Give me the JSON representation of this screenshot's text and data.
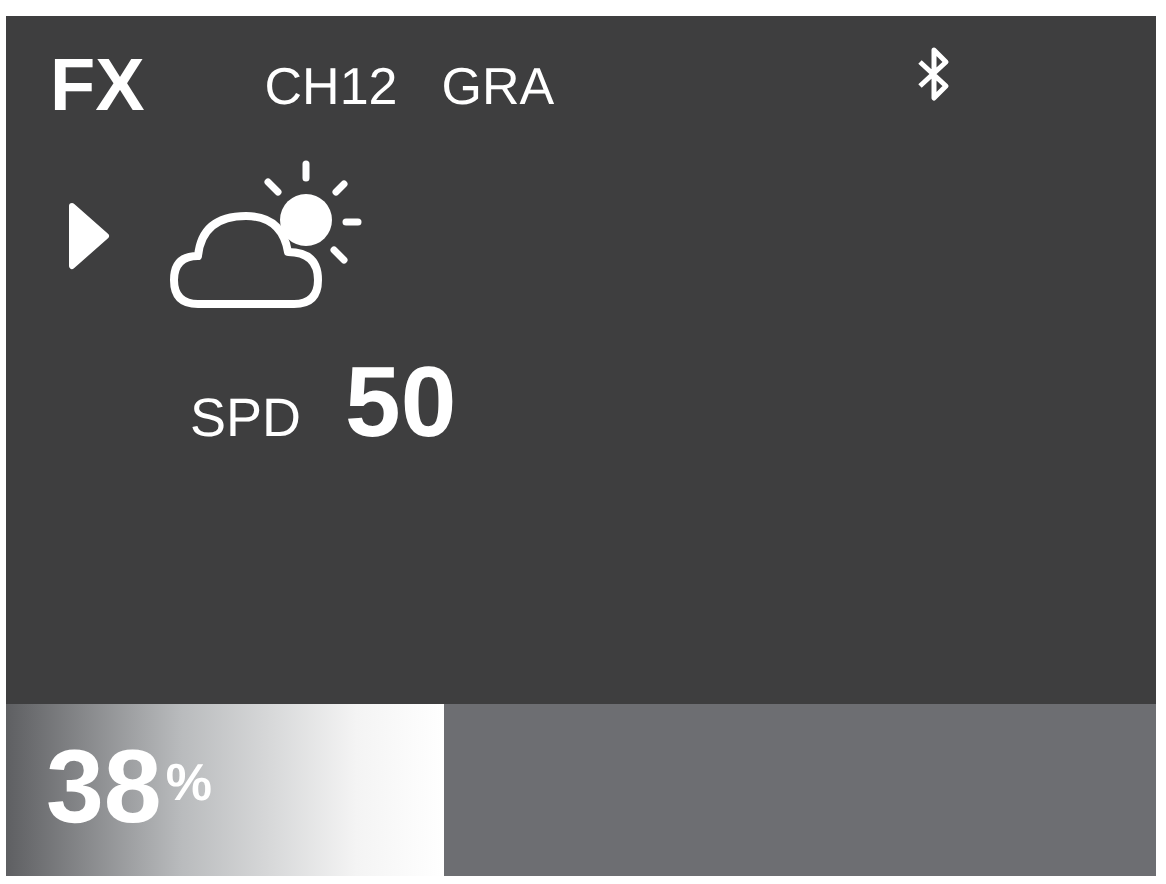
{
  "header": {
    "mode": "FX",
    "channel": "CH12",
    "preset": "GRA"
  },
  "speed": {
    "label": "SPD",
    "value": "50"
  },
  "meter": {
    "level": 0.38,
    "value": "38",
    "unit": "%"
  }
}
